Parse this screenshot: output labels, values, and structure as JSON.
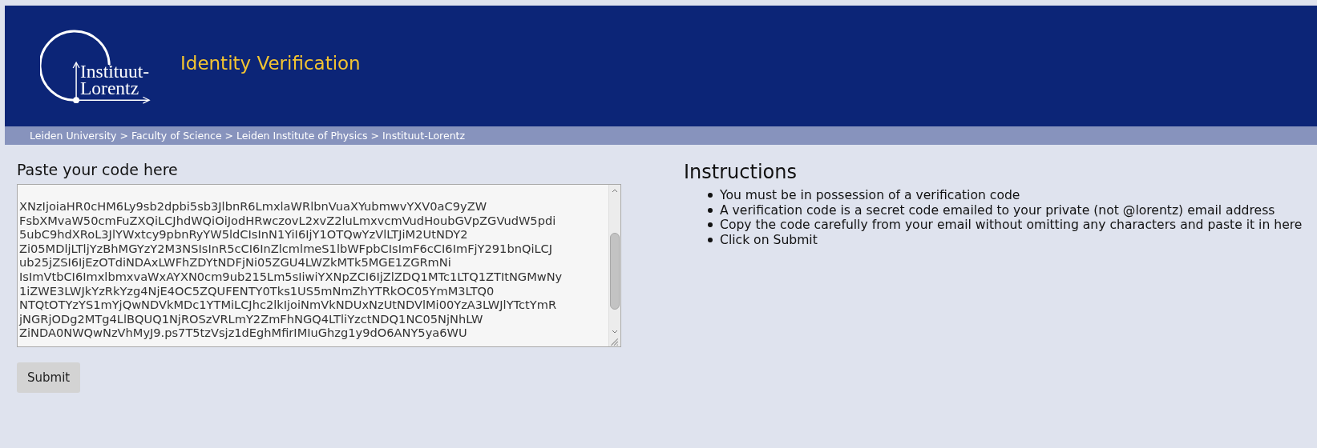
{
  "header": {
    "logo_lines": [
      "Instituut-",
      "Lorentz"
    ],
    "title": "Identity Verification"
  },
  "breadcrumb": "Leiden University > Faculty of Science > Leiden Institute of Physics > Instituut-Lorentz",
  "form": {
    "label": "Paste your code here",
    "code_lines": [
      "XNzIjoiaHR0cHM6Ly9sb2dpbi5sb3JlbnR6LmxlaWRlbnVuaXYubmwvYXV0aC9yZW",
      "FsbXMvaW50cmFuZXQiLCJhdWQiOiJodHRwczovL2xvZ2luLmxvcmVudHoubGVpZGVudW5pdi",
      "5ubC9hdXRoL3JlYWxtcy9pbnRyYW5ldCIsInN1YiI6IjY1OTQwYzVlLTJiM2UtNDY2",
      "Zi05MDljLTljYzBhMGYzY2M3NSIsInR5cCI6InZlcmlmeS1lbWFpbCIsImF6cCI6ImFjY291bnQiLCJ",
      "ub25jZSI6IjEzOTdiNDAxLWFhZDYtNDFjNi05ZGU4LWZkMTk5MGE1ZGRmNi",
      "IsImVtbCI6ImxlbmxvaWxAYXN0cm9ub215Lm5sIiwiYXNpZCI6IjZlZDQ1MTc1LTQ1ZTItNGMwNy",
      "1iZWE3LWJkYzRkYzg4NjE4OC5ZQUFENTY0Tks1US5mNmZhYTRkOC05YmM3LTQ0",
      "NTQtOTYzYS1mYjQwNDVkMDc1YTMiLCJhc2lkIjoiNmVkNDUxNzUtNDVlMi00YzA3LWJlYTctYmR",
      "jNGRjODg2MTg4LlBQUQ1NjROSzVRLmY2ZmFhNGQ4LTliYzctNDQ1NC05NjNhLW",
      "ZiNDA0NWQwNzVhMyJ9.ps7T5tzVsjz1dEghMfirIMIuGhzg1y9dO6ANY5ya6WU"
    ],
    "submit": "Submit"
  },
  "instructions": {
    "title": "Instructions",
    "items": [
      "You must be in possession of a verification code",
      "A verification code is a secret code emailed to your private (not @lorentz) email address",
      "Copy the code carefully from your email without omitting any characters and paste it in here",
      "Click on Submit"
    ]
  }
}
